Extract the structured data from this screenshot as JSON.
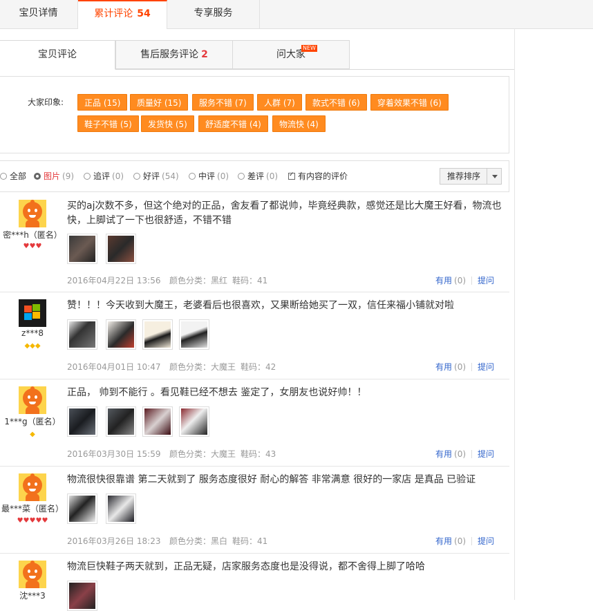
{
  "top_tabs": [
    {
      "label": "宝贝详情"
    },
    {
      "label": "累计评论",
      "count": "54"
    },
    {
      "label": "专享服务"
    }
  ],
  "sub_tabs": [
    {
      "label": "宝贝评论"
    },
    {
      "label": "售后服务评论",
      "count": "2"
    },
    {
      "label": "问大家",
      "badge": "NEW"
    }
  ],
  "impression": {
    "label": "大家印象:",
    "tags": [
      "正品 (15)",
      "质量好 (15)",
      "服务不错 (7)",
      "人群 (7)",
      "款式不错 (6)",
      "穿着效果不错 (6)",
      "鞋子不错 (5)",
      "发货快 (5)",
      "舒适度不错 (4)",
      "物流快 (4)"
    ]
  },
  "filters": {
    "options": [
      {
        "label": "全部",
        "count": ""
      },
      {
        "label": "图片",
        "count": "(9)"
      },
      {
        "label": "追评",
        "count": "(0)"
      },
      {
        "label": "好评",
        "count": "(54)"
      },
      {
        "label": "中评",
        "count": "(0)"
      },
      {
        "label": "差评",
        "count": "(0)"
      }
    ],
    "content_only": "有内容的评价",
    "sort_label": "推荐排序"
  },
  "reviews": [
    {
      "user": "密***h（匿名）",
      "rank": "♥♥♥",
      "text": "买的aj次数不多，但这个绝对的正品，舍友看了都说帅，毕竟经典款，感觉还是比大魔王好看，物流也快，上脚试了一下也很舒适，不错不错",
      "date": "2016年04月22日 13:56",
      "color": "颜色分类：黑红",
      "size": "鞋码：41",
      "useful": "有用",
      "useful_count": "(0)",
      "ask": "提问"
    },
    {
      "user": "z***8",
      "rank": "◆◆◆",
      "text": "赞！！！今天收到大魔王，老婆看后也很喜欢，又果断给她买了一双，信任来福小铺就对啦",
      "date": "2016年04月01日 10:47",
      "color": "颜色分类：大魔王",
      "size": "鞋码：42",
      "useful": "有用",
      "useful_count": "(0)",
      "ask": "提问"
    },
    {
      "user": "1***g（匿名）",
      "rank": "◆",
      "text": "正品， 帅到不能行 。看见鞋已经不想去 鉴定了，女朋友也说好帅！！",
      "date": "2016年03月30日 15:59",
      "color": "颜色分类：大魔王",
      "size": "鞋码：43",
      "useful": "有用",
      "useful_count": "(0)",
      "ask": "提问"
    },
    {
      "user": "最***菜（匿名）",
      "rank": "♥♥♥♥♥",
      "text": "物流很快很靠谱 第二天就到了 服务态度很好 耐心的解答 非常满意 很好的一家店 是真品 已验证",
      "date": "2016年03月26日 18:23",
      "color": "颜色分类：黑白",
      "size": "鞋码：41",
      "useful": "有用",
      "useful_count": "(0)",
      "ask": "提问"
    },
    {
      "user": "沈***3",
      "rank": "",
      "text": "物流巨快鞋子两天就到，正品无疑，店家服务态度也是没得说，都不舍得上脚了哈哈",
      "date": "",
      "color": "",
      "size": "",
      "useful": "",
      "useful_count": "",
      "ask": ""
    }
  ],
  "colors": {
    "accent": "#ff4400",
    "tag_bg": "#ff8b20",
    "link": "#3366cc",
    "heart": "#e4393c",
    "diamond": "#f5b800"
  }
}
